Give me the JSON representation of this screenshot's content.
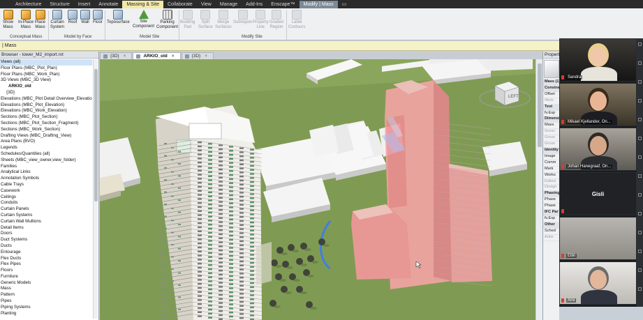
{
  "ribbon_tabs": [
    "Architecture",
    "Structure",
    "Insert",
    "Annotate",
    "Massing & Site",
    "Collaborate",
    "View",
    "Manage",
    "Add-Ins",
    "Enscape™",
    "Modify | Mass"
  ],
  "ribbon_active_tab": "Massing & Site",
  "ribbon_buttons": {
    "show_mass": "Show\nMass",
    "in_place_mass": "In-Place\nMass",
    "place_mass": "Place\nMass",
    "curtain_system": "Curtain\nSystem",
    "roof": "Roof",
    "wall": "Wall",
    "floor": "Floor",
    "toposurface": "Toposurface",
    "site_component": "Site\nComponent",
    "parking_component": "Parking\nComponent",
    "building_pad": "Building\nPad",
    "split_surface": "Split\nSurface",
    "merge_surfaces": "Merge\nSurfaces",
    "subregion": "Subregion",
    "property_line": "Property\nLine",
    "graded_region": "Graded\nRegion",
    "label_contours": "Label\nContours"
  },
  "ribbon_groups": {
    "conceptual_mass": "Conceptual Mass",
    "model_by_face": "Model by Face",
    "model_site": "Model Site",
    "modify_site": "Modify Site"
  },
  "options_bar": "| Mass",
  "project_browser": {
    "title": "Browser - tower_M2_import.rvt",
    "items": [
      {
        "label": "Views (all)",
        "style": "sel"
      },
      {
        "label": "Floor Plans (MBC_Plot_Plan)",
        "style": ""
      },
      {
        "label": "Floor Plans (MBC_Work_Plan)",
        "style": ""
      },
      {
        "label": "3D Views (MBC_3D View)",
        "style": ""
      },
      {
        "label": "ARKIO_old",
        "style": "bold ind2"
      },
      {
        "label": "{3D}",
        "style": "ind1"
      },
      {
        "label": "Elevations (MBC_Plot Detail Overview_Elevation)",
        "style": ""
      },
      {
        "label": "Elevations (MBC_Plot_Elevation)",
        "style": ""
      },
      {
        "label": "Elevations (MBC_Work_Elevation)",
        "style": ""
      },
      {
        "label": "Sections (MBC_Plot_Section)",
        "style": ""
      },
      {
        "label": "Sections (MBC_Plot_Section_Fragment)",
        "style": ""
      },
      {
        "label": "Sections (MBC_Work_Section)",
        "style": ""
      },
      {
        "label": "Drafting Views (MBC_Drafting_View)",
        "style": ""
      },
      {
        "label": "Area Plans (BVO)",
        "style": ""
      },
      {
        "label": "Legends",
        "style": ""
      },
      {
        "label": "Schedules/Quantities (all)",
        "style": ""
      },
      {
        "label": "Sheets (MBC_view_owner,view_folder)",
        "style": ""
      },
      {
        "label": "Families",
        "style": ""
      },
      {
        "label": "Analytical Links",
        "style": ""
      },
      {
        "label": "Annotation Symbols",
        "style": ""
      },
      {
        "label": "Cable Trays",
        "style": ""
      },
      {
        "label": "Casework",
        "style": ""
      },
      {
        "label": "Ceilings",
        "style": ""
      },
      {
        "label": "Conduits",
        "style": ""
      },
      {
        "label": "Curtain Panels",
        "style": ""
      },
      {
        "label": "Curtain Systems",
        "style": ""
      },
      {
        "label": "Curtain Wall Mullions",
        "style": ""
      },
      {
        "label": "Detail Items",
        "style": ""
      },
      {
        "label": "Doors",
        "style": ""
      },
      {
        "label": "Duct Systems",
        "style": ""
      },
      {
        "label": "Ducts",
        "style": ""
      },
      {
        "label": "Entourage",
        "style": ""
      },
      {
        "label": "Flex Ducts",
        "style": ""
      },
      {
        "label": "Flex Pipes",
        "style": ""
      },
      {
        "label": "Floors",
        "style": ""
      },
      {
        "label": "Furniture",
        "style": ""
      },
      {
        "label": "Generic Models",
        "style": ""
      },
      {
        "label": "Mass",
        "style": ""
      },
      {
        "label": "Pattern",
        "style": ""
      },
      {
        "label": "Pipes",
        "style": ""
      },
      {
        "label": "Piping Systems",
        "style": ""
      },
      {
        "label": "Planting",
        "style": ""
      }
    ]
  },
  "view_tabs": [
    {
      "label": "{3D}",
      "active": false
    },
    {
      "label": "ARKIO_old",
      "active": true
    },
    {
      "label": "{3D}",
      "active": false
    }
  ],
  "viewcube_label": "LEFT",
  "properties": {
    "title": "Properties",
    "items": [
      {
        "label": "Mass (1)",
        "cls": "hdr"
      },
      {
        "label": "Constraints",
        "cls": "hdr"
      },
      {
        "label": "Offset",
        "cls": ""
      },
      {
        "label": "Work",
        "cls": "dim"
      },
      {
        "label": "Text",
        "cls": "hdr"
      },
      {
        "label": "fv.Esp",
        "cls": ""
      },
      {
        "label": "Dimensions",
        "cls": "hdr"
      },
      {
        "label": "Mass",
        "cls": ""
      },
      {
        "label": "Gross",
        "cls": "dim"
      },
      {
        "label": "Gross",
        "cls": "dim"
      },
      {
        "label": "Gross",
        "cls": "dim"
      },
      {
        "label": "Identity",
        "cls": "hdr"
      },
      {
        "label": "Image",
        "cls": ""
      },
      {
        "label": "Comm",
        "cls": ""
      },
      {
        "label": "Mark",
        "cls": ""
      },
      {
        "label": "Works",
        "cls": ""
      },
      {
        "label": "Edited",
        "cls": "dim"
      },
      {
        "label": "Design",
        "cls": "dim"
      },
      {
        "label": "Phasing",
        "cls": "hdr"
      },
      {
        "label": "Phase",
        "cls": ""
      },
      {
        "label": "Phase",
        "cls": ""
      },
      {
        "label": "IFC Par",
        "cls": "hdr"
      },
      {
        "label": "fv.Esp",
        "cls": ""
      },
      {
        "label": "Other",
        "cls": "hdr"
      },
      {
        "label": "Sched",
        "cls": ""
      },
      {
        "label": "Arkie",
        "cls": "dim"
      }
    ]
  },
  "participants": [
    {
      "name": "Sandra",
      "muted": false
    },
    {
      "name": "Mikael Kjellander, On...",
      "muted": false
    },
    {
      "name": "Johan Hanegraaf, On...",
      "muted": false
    },
    {
      "name": "Gisli",
      "muted": false
    },
    {
      "name": "Eilin",
      "muted": true
    },
    {
      "name": "Ami",
      "muted": true
    }
  ],
  "colors": {
    "ground": "#7f9b53",
    "mass": "#f28d8f",
    "ribbon_active": "#f2e9a8",
    "context_tab": "#7b8a97"
  }
}
